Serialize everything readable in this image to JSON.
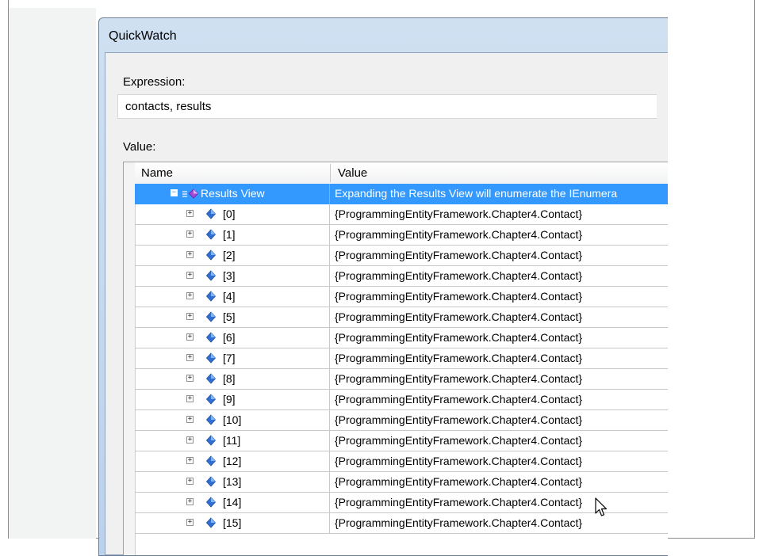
{
  "window": {
    "title": "QuickWatch"
  },
  "expression": {
    "label": "Expression:",
    "value": "contacts, results"
  },
  "value_section": {
    "label": "Value:"
  },
  "grid": {
    "columns": {
      "name": "Name",
      "value": "Value"
    },
    "results_view": {
      "name": "Results View",
      "value": "Expanding the Results View will enumerate the IEnumera",
      "expanded": true,
      "selected": true
    },
    "items": [
      {
        "name": "[0]",
        "value": "{ProgrammingEntityFramework.Chapter4.Contact}"
      },
      {
        "name": "[1]",
        "value": "{ProgrammingEntityFramework.Chapter4.Contact}"
      },
      {
        "name": "[2]",
        "value": "{ProgrammingEntityFramework.Chapter4.Contact}"
      },
      {
        "name": "[3]",
        "value": "{ProgrammingEntityFramework.Chapter4.Contact}"
      },
      {
        "name": "[4]",
        "value": "{ProgrammingEntityFramework.Chapter4.Contact}"
      },
      {
        "name": "[5]",
        "value": "{ProgrammingEntityFramework.Chapter4.Contact}"
      },
      {
        "name": "[6]",
        "value": "{ProgrammingEntityFramework.Chapter4.Contact}"
      },
      {
        "name": "[7]",
        "value": "{ProgrammingEntityFramework.Chapter4.Contact}"
      },
      {
        "name": "[8]",
        "value": "{ProgrammingEntityFramework.Chapter4.Contact}"
      },
      {
        "name": "[9]",
        "value": "{ProgrammingEntityFramework.Chapter4.Contact}"
      },
      {
        "name": "[10]",
        "value": "{ProgrammingEntityFramework.Chapter4.Contact}"
      },
      {
        "name": "[11]",
        "value": "{ProgrammingEntityFramework.Chapter4.Contact}"
      },
      {
        "name": "[12]",
        "value": "{ProgrammingEntityFramework.Chapter4.Contact}"
      },
      {
        "name": "[13]",
        "value": "{ProgrammingEntityFramework.Chapter4.Contact}"
      },
      {
        "name": "[14]",
        "value": "{ProgrammingEntityFramework.Chapter4.Contact}"
      },
      {
        "name": "[15]",
        "value": "{ProgrammingEntityFramework.Chapter4.Contact}"
      }
    ]
  },
  "icons": {
    "expand": "plus-box-icon",
    "collapse": "minus-box-icon",
    "item": "field-diamond-icon",
    "results_view": "results-view-icon",
    "cursor": "mouse-pointer-icon"
  },
  "colors": {
    "selection": "#3399ff",
    "field_icon": "#2f6fd6",
    "results_icon": "#a64ad8"
  }
}
